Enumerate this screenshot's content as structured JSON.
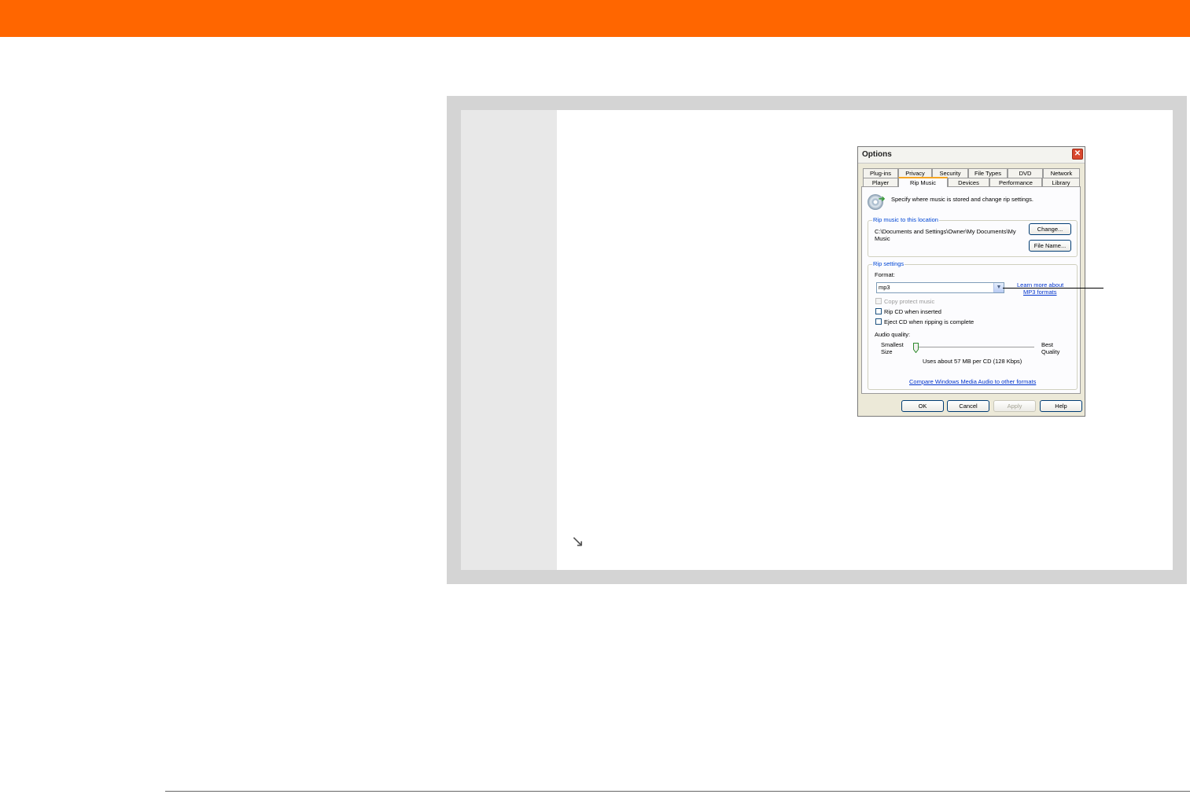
{
  "dialog": {
    "title": "Options",
    "tabs_row1": [
      "Plug-ins",
      "Privacy",
      "Security",
      "File Types",
      "DVD",
      "Network"
    ],
    "tabs_row2": [
      "Player",
      "Rip Music",
      "Devices",
      "Performance",
      "Library"
    ],
    "active_tab": "Rip Music",
    "description": "Specify where music is stored and change rip settings.",
    "location_group": {
      "label": "Rip music to this location",
      "path_line1": "C:\\Documents and Settings\\Owner\\My Documents\\My",
      "path_line2": "Music",
      "change_button": "Change...",
      "filename_button": "File Name..."
    },
    "settings_group": {
      "label": "Rip settings",
      "format_label": "Format:",
      "format_value": "mp3",
      "learn_more_line1": "Learn more about",
      "learn_more_line2": "MP3 formats",
      "copy_protect": "Copy protect music",
      "rip_cd": "Rip CD when inserted",
      "eject_cd": "Eject CD when ripping is complete",
      "audio_quality_label": "Audio quality:",
      "smallest_line1": "Smallest",
      "smallest_line2": "Size",
      "best_line1": "Best",
      "best_line2": "Quality",
      "usage": "Uses about 57 MB per CD (128 Kbps)",
      "compare_link": "Compare Windows Media Audio to other formats"
    },
    "buttons": {
      "ok": "OK",
      "cancel": "Cancel",
      "apply": "Apply",
      "help": "Help"
    }
  },
  "colors": {
    "header_bar": "#ff6600",
    "panel_frame": "#d4d4d4",
    "panel_sidebar": "#e8e8e8"
  },
  "icons": {
    "continue_arrow": "↘",
    "close": "✕",
    "dropdown": "▼"
  }
}
